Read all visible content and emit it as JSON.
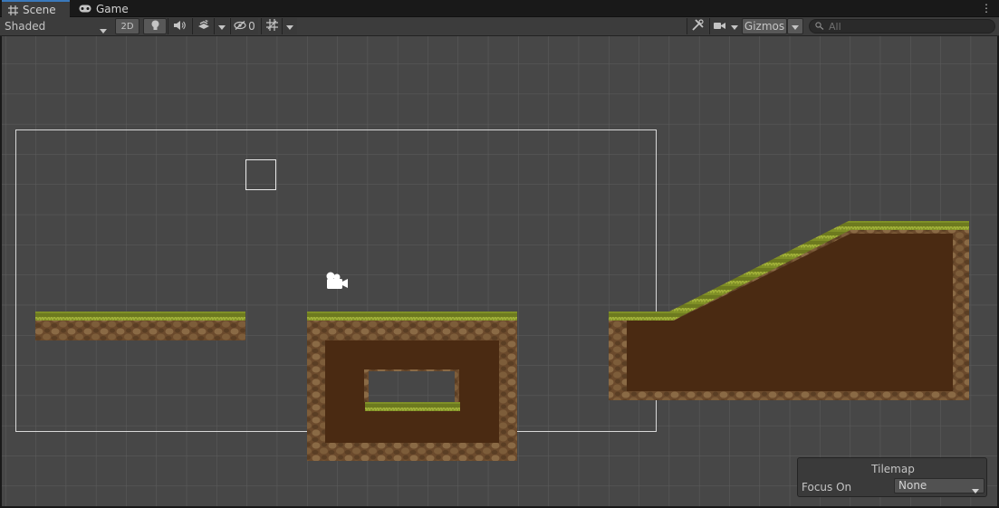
{
  "tabs": [
    {
      "label": "Scene",
      "icon": "grid-icon",
      "active": true
    },
    {
      "label": "Game",
      "icon": "gamepad-icon",
      "active": false
    }
  ],
  "toolbar": {
    "shading_mode": "Shaded",
    "mode_2d": "2D",
    "hidden_count": "0",
    "gizmos_label": "Gizmos",
    "search_placeholder": "All"
  },
  "tilemap_overlay": {
    "title": "Tilemap",
    "focus_label": "Focus On",
    "focus_value": "None"
  },
  "colors": {
    "accent": "#3a79bb",
    "scene_background": "#474747",
    "grid_line": "#5d5d5d",
    "grass": "#8a9a2a",
    "dirt": "#4a2a12",
    "stone": "#7a5a38"
  }
}
